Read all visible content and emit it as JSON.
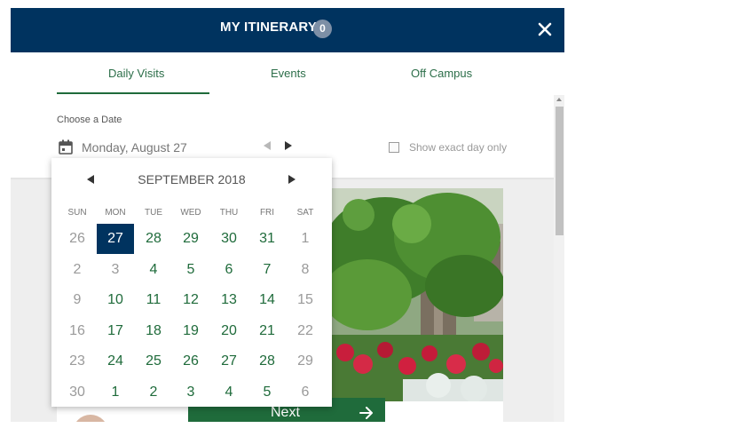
{
  "header": {
    "title": "MY ITINERARY",
    "badge_count": "0"
  },
  "tabs": [
    {
      "label": "Daily Visits",
      "active": true
    },
    {
      "label": "Events",
      "active": false
    },
    {
      "label": "Off Campus",
      "active": false
    }
  ],
  "date_picker": {
    "label": "Choose a Date",
    "value": "Monday, August 27",
    "exact_day_label": "Show exact day only",
    "exact_day_checked": false
  },
  "calendar": {
    "month_title": "SEPTEMBER 2018",
    "weekdays": [
      "SUN",
      "MON",
      "TUE",
      "WED",
      "THU",
      "FRI",
      "SAT"
    ],
    "weeks": [
      [
        {
          "d": "26",
          "s": "other"
        },
        {
          "d": "27",
          "s": "selected"
        },
        {
          "d": "28",
          "s": "current"
        },
        {
          "d": "29",
          "s": "current"
        },
        {
          "d": "30",
          "s": "current"
        },
        {
          "d": "31",
          "s": "current"
        },
        {
          "d": "1",
          "s": "other"
        }
      ],
      [
        {
          "d": "2",
          "s": "other"
        },
        {
          "d": "3",
          "s": "other"
        },
        {
          "d": "4",
          "s": "current"
        },
        {
          "d": "5",
          "s": "current"
        },
        {
          "d": "6",
          "s": "current"
        },
        {
          "d": "7",
          "s": "current"
        },
        {
          "d": "8",
          "s": "other"
        }
      ],
      [
        {
          "d": "9",
          "s": "other"
        },
        {
          "d": "10",
          "s": "current"
        },
        {
          "d": "11",
          "s": "current"
        },
        {
          "d": "12",
          "s": "current"
        },
        {
          "d": "13",
          "s": "current"
        },
        {
          "d": "14",
          "s": "current"
        },
        {
          "d": "15",
          "s": "other"
        }
      ],
      [
        {
          "d": "16",
          "s": "other"
        },
        {
          "d": "17",
          "s": "current"
        },
        {
          "d": "18",
          "s": "current"
        },
        {
          "d": "19",
          "s": "current"
        },
        {
          "d": "20",
          "s": "current"
        },
        {
          "d": "21",
          "s": "current"
        },
        {
          "d": "22",
          "s": "other"
        }
      ],
      [
        {
          "d": "23",
          "s": "other"
        },
        {
          "d": "24",
          "s": "current"
        },
        {
          "d": "25",
          "s": "current"
        },
        {
          "d": "26",
          "s": "current"
        },
        {
          "d": "27",
          "s": "current"
        },
        {
          "d": "28",
          "s": "current"
        },
        {
          "d": "29",
          "s": "other"
        }
      ],
      [
        {
          "d": "30",
          "s": "other"
        },
        {
          "d": "1",
          "s": "current"
        },
        {
          "d": "2",
          "s": "current"
        },
        {
          "d": "3",
          "s": "current"
        },
        {
          "d": "4",
          "s": "current"
        },
        {
          "d": "5",
          "s": "current"
        },
        {
          "d": "6",
          "s": "other"
        }
      ]
    ]
  },
  "card": {
    "next_label": "Next"
  },
  "icons": {
    "close": "close-icon",
    "calendar": "calendar-icon",
    "prev_date": "chevron-left-icon",
    "next_date": "chevron-right-icon",
    "next_arrow": "arrow-right-icon"
  },
  "colors": {
    "header_bg": "#00335f",
    "accent_green": "#1f6b3b",
    "selected_day_bg": "#00335f",
    "badge_bg": "#7d8fa6"
  }
}
